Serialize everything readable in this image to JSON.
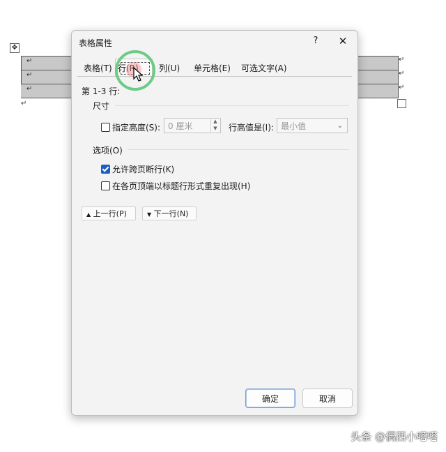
{
  "document": {
    "row_mark": "↵",
    "table_move_icon": "move-handle-icon"
  },
  "dialog": {
    "title": "表格属性",
    "help_label": "?",
    "close_label": "✕",
    "tabs": [
      {
        "label": "表格(T)",
        "active": false
      },
      {
        "label": "行(R)",
        "active": true
      },
      {
        "label": "列(U)",
        "active": false
      },
      {
        "label": "单元格(E)",
        "active": false
      },
      {
        "label": "可选文字(A)",
        "active": false
      }
    ],
    "rows_range": "第 1-3 行:",
    "size_section": "尺寸",
    "specify_height_label": "指定高度(S):",
    "specify_height_checked": false,
    "height_value": "0 厘米",
    "row_height_is_label": "行高值是(I):",
    "row_height_is_value": "最小值",
    "options_section": "选项(O)",
    "allow_break_label": "允许跨页断行(K)",
    "allow_break_checked": true,
    "repeat_header_label": "在各页顶端以标题行形式重复出现(H)",
    "repeat_header_checked": false,
    "prev_row_label": "上一行(P)",
    "next_row_label": "下一行(N)",
    "ok_label": "确定",
    "cancel_label": "取消"
  },
  "watermark": "头条 @偶西小嗒嗒",
  "colors": {
    "highlight_ring": "#6ccb84",
    "checkbox_checked": "#1b5fbf"
  }
}
